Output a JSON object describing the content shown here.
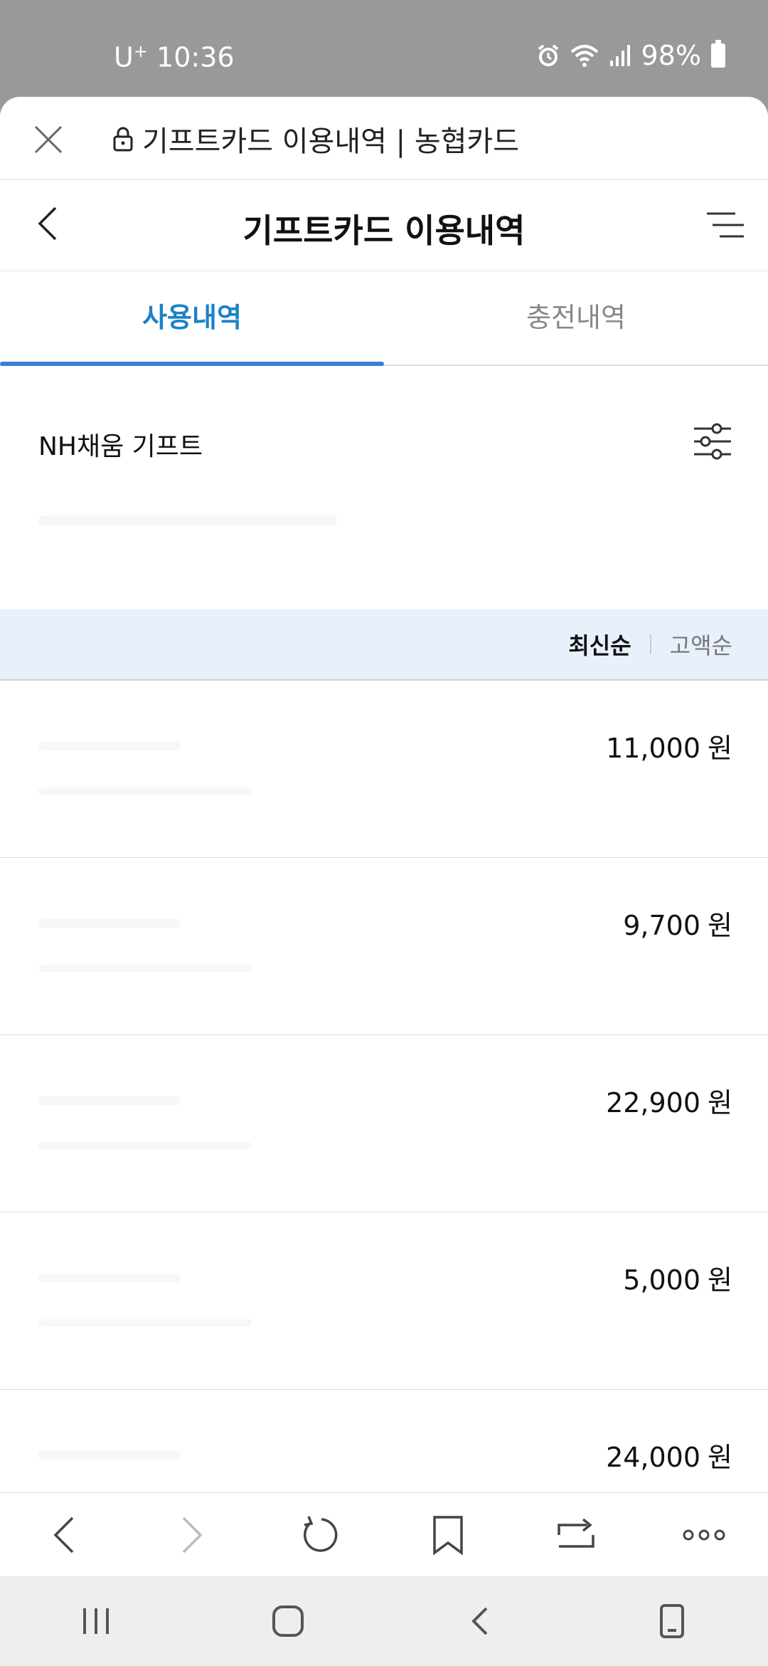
{
  "status_bar": {
    "carrier": "U",
    "carrier_sup": "+",
    "time": "10:36",
    "battery": "98%",
    "icons": [
      "alarm-icon",
      "wifi-icon",
      "signal-icon",
      "battery-icon"
    ]
  },
  "browser": {
    "url_title": "기프트카드 이용내역 | 농협카드"
  },
  "page": {
    "title": "기프트카드 이용내역"
  },
  "tabs": [
    {
      "label": "사용내역",
      "active": true
    },
    {
      "label": "충전내역",
      "active": false
    }
  ],
  "card": {
    "name": "NH채움 기프트"
  },
  "sort": {
    "latest": "최신순",
    "amount": "고액순"
  },
  "transactions": [
    {
      "amount": "11,000",
      "unit": "원"
    },
    {
      "amount": "9,700",
      "unit": "원"
    },
    {
      "amount": "22,900",
      "unit": "원"
    },
    {
      "amount": "5,000",
      "unit": "원"
    },
    {
      "amount": "24,000",
      "unit": "원"
    }
  ],
  "colors": {
    "accent": "#1a82c7",
    "tab_underline": "#3a7fd9",
    "sort_bar_bg": "#e8f0fb",
    "status_bg": "#999999"
  }
}
